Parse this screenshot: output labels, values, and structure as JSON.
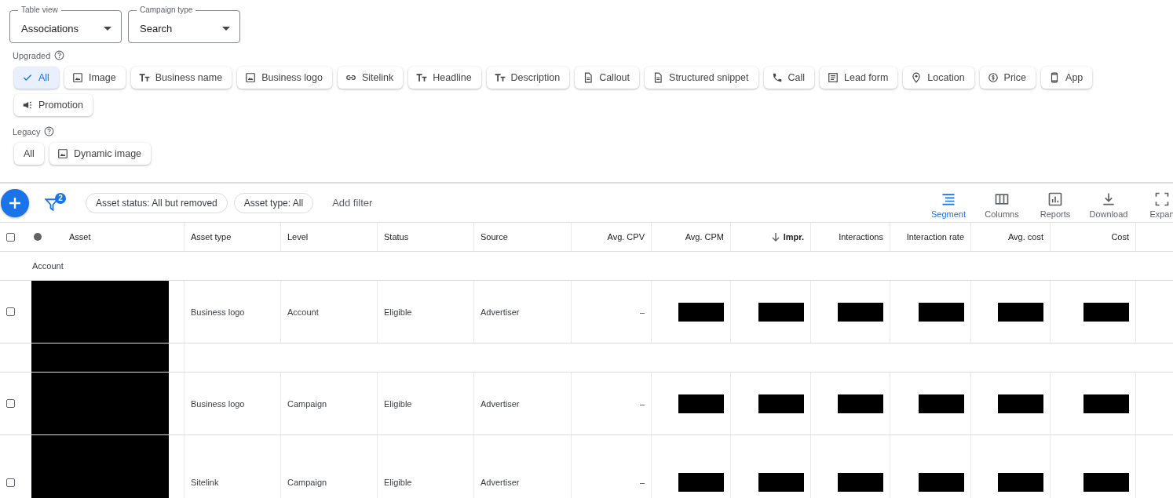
{
  "selectors": [
    {
      "label": "Table view",
      "value": "Associations"
    },
    {
      "label": "Campaign type",
      "value": "Search"
    }
  ],
  "upgraded": {
    "title": "Upgraded",
    "chips": [
      {
        "label": "All",
        "kind": "all",
        "selected": true
      },
      {
        "label": "Image",
        "kind": "image",
        "selected": false
      },
      {
        "label": "Business name",
        "kind": "text",
        "selected": false
      },
      {
        "label": "Business logo",
        "kind": "image",
        "selected": false
      },
      {
        "label": "Sitelink",
        "kind": "link",
        "selected": false
      },
      {
        "label": "Headline",
        "kind": "text",
        "selected": false
      },
      {
        "label": "Description",
        "kind": "text",
        "selected": false
      },
      {
        "label": "Callout",
        "kind": "document",
        "selected": false
      },
      {
        "label": "Structured snippet",
        "kind": "document",
        "selected": false
      },
      {
        "label": "Call",
        "kind": "call",
        "selected": false
      },
      {
        "label": "Lead form",
        "kind": "form",
        "selected": false
      },
      {
        "label": "Location",
        "kind": "location",
        "selected": false
      },
      {
        "label": "Price",
        "kind": "price",
        "selected": false
      },
      {
        "label": "App",
        "kind": "app",
        "selected": false
      },
      {
        "label": "Promotion",
        "kind": "promotion",
        "selected": false
      }
    ]
  },
  "legacy": {
    "title": "Legacy",
    "chips": [
      {
        "label": "All",
        "kind": "all",
        "selected": false
      },
      {
        "label": "Dynamic image",
        "kind": "image",
        "selected": false
      }
    ]
  },
  "toolbar": {
    "filter_count": "2",
    "filters": [
      "Asset status: All but removed",
      "Asset type: All"
    ],
    "add_filter": "Add filter",
    "actions": [
      {
        "label": "Segment",
        "kind": "segment",
        "selected": true
      },
      {
        "label": "Columns",
        "kind": "columns",
        "selected": false
      },
      {
        "label": "Reports",
        "kind": "reports",
        "selected": false
      },
      {
        "label": "Download",
        "kind": "download",
        "selected": false
      },
      {
        "label": "Expan",
        "kind": "expand",
        "selected": false
      }
    ]
  },
  "table": {
    "all_checked": false,
    "columns": [
      {
        "label": "Asset",
        "kind": "text",
        "sorted": false
      },
      {
        "label": "Asset type",
        "kind": "text",
        "sorted": false
      },
      {
        "label": "Level",
        "kind": "text",
        "sorted": false
      },
      {
        "label": "Status",
        "kind": "text",
        "sorted": false
      },
      {
        "label": "Source",
        "kind": "text",
        "sorted": false
      },
      {
        "label": "Avg. CPV",
        "kind": "metric",
        "sorted": false
      },
      {
        "label": "Avg. CPM",
        "kind": "metric",
        "sorted": false
      },
      {
        "label": "Impr.",
        "kind": "metric",
        "sorted": true
      },
      {
        "label": "Interactions",
        "kind": "metric",
        "sorted": false
      },
      {
        "label": "Interaction rate",
        "kind": "metric",
        "sorted": false
      },
      {
        "label": "Avg. cost",
        "kind": "metric",
        "sorted": false
      },
      {
        "label": "Cost",
        "kind": "metric",
        "sorted": false
      }
    ],
    "rows": [
      {
        "kind": "group",
        "label": "Account"
      },
      {
        "kind": "data",
        "checked": false,
        "redacted": true,
        "asset_type": "Business logo",
        "level": "Account",
        "status": "Eligible",
        "source": "Advertiser",
        "avg_cpv": "–"
      },
      {
        "kind": "spacer",
        "redacted": true
      },
      {
        "kind": "data",
        "checked": false,
        "redacted": true,
        "asset_type": "Business logo",
        "level": "Campaign",
        "status": "Eligible",
        "source": "Advertiser",
        "avg_cpv": "–"
      },
      {
        "kind": "data",
        "checked": false,
        "redacted": true,
        "asset_type": "Sitelink",
        "level": "Campaign",
        "status": "Eligible",
        "source": "Advertiser",
        "avg_cpv": "–"
      }
    ]
  }
}
